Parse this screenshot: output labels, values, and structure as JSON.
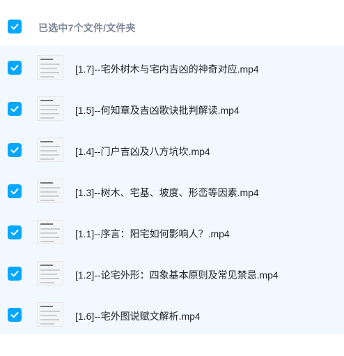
{
  "header": {
    "title": "已选中7个文件/文件夹",
    "checked": true
  },
  "files": [
    {
      "name": "[1.7]--宅外树木与宅内吉凶的神奇对应.mp4",
      "checked": true
    },
    {
      "name": "[1.5]--何知章及吉凶歌诀批判解读.mp4",
      "checked": true
    },
    {
      "name": "[1.4]--门户吉凶及八方坑坎.mp4",
      "checked": true
    },
    {
      "name": "[1.3]--树木、宅基、坡度、形峦等因素.mp4",
      "checked": true
    },
    {
      "name": "[1.1]--序言：阳宅如何影响人？.mp4",
      "checked": true
    },
    {
      "name": "[1.2]--论宅外形：四象基本原则及常见禁忌.mp4",
      "checked": true
    },
    {
      "name": "[1.6]--宅外图说赋文解析.mp4",
      "checked": true
    }
  ],
  "colors": {
    "accent": "#06a7ff",
    "list_background": "#f1f8ff",
    "header_text": "#7c8797",
    "file_text": "#1f2329"
  }
}
